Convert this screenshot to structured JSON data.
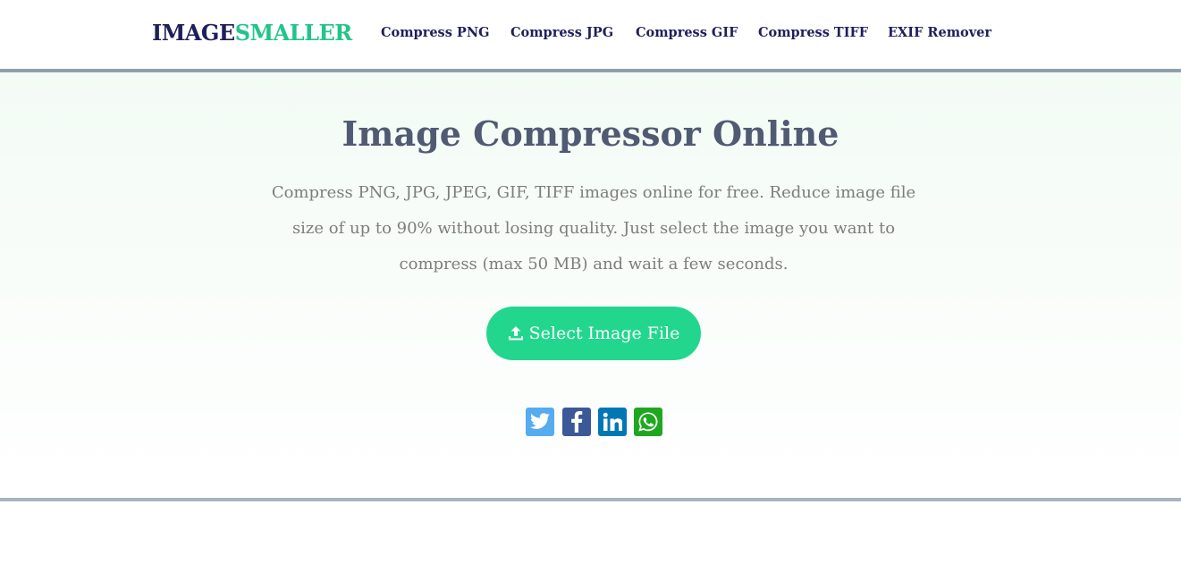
{
  "header": {
    "logo_part1": "IMAGE",
    "logo_part2": "SMALLER",
    "nav": [
      {
        "label": "Compress PNG"
      },
      {
        "label": "Compress JPG"
      },
      {
        "label": "Compress GIF"
      },
      {
        "label": "Compress TIFF"
      },
      {
        "label": "EXIF Remover"
      }
    ]
  },
  "hero": {
    "title": "Image Compressor Online",
    "description": "Compress PNG, JPG, JPEG, GIF, TIFF images online for free. Reduce image file size of up to 90% without losing quality. Just select the image you want to compress (max 50 MB) and wait a few seconds.",
    "select_button_label": "Select Image File"
  },
  "share": [
    {
      "icon": "twitter-icon",
      "color": "#55acee"
    },
    {
      "icon": "facebook-icon",
      "color": "#3b5998"
    },
    {
      "icon": "linkedin-icon",
      "color": "#0077b5"
    },
    {
      "icon": "whatsapp-icon",
      "color": "#1fa81f"
    }
  ],
  "colors": {
    "brand_dark": "#1f1f5c",
    "brand_green": "#22c48a",
    "button_green": "#22d68d",
    "title_color": "#515a73",
    "rule_color": "#8e9fb0"
  }
}
